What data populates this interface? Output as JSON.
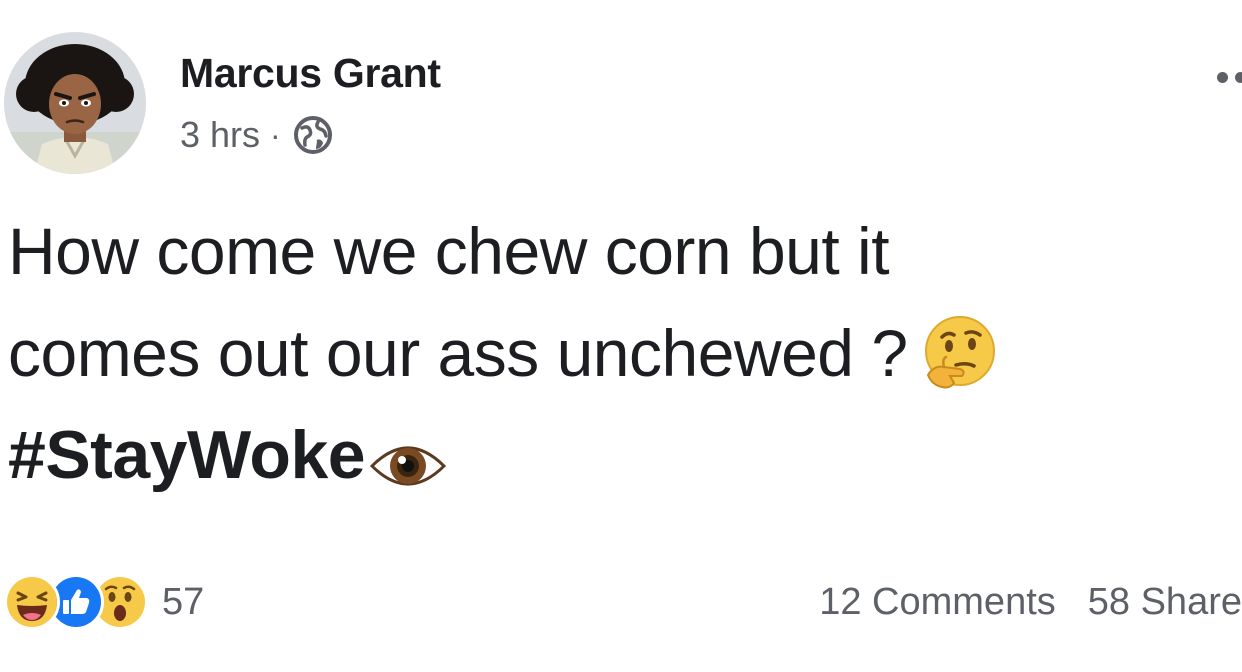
{
  "post": {
    "author_name": "Marcus Grant",
    "timestamp": "3 hrs",
    "separator": "·",
    "privacy_icon": "globe-icon",
    "more_icon": "more-options-icon",
    "text_line_1": "How come we chew corn but it",
    "text_line_2": "comes out our ass unchewed ?",
    "hashtag": "#StayWoke",
    "emoji_1": "thinking-face",
    "emoji_2": "eye"
  },
  "footer": {
    "reactions": [
      "laughing-reaction",
      "like-reaction",
      "wow-reaction"
    ],
    "reaction_count": "57",
    "comments": "12 Comments",
    "shares": "58 Share"
  },
  "colors": {
    "text": "#1c1e21",
    "secondary_text": "#5d6167",
    "like_blue": "#1877f2",
    "reaction_yellow": "#f7c948"
  }
}
